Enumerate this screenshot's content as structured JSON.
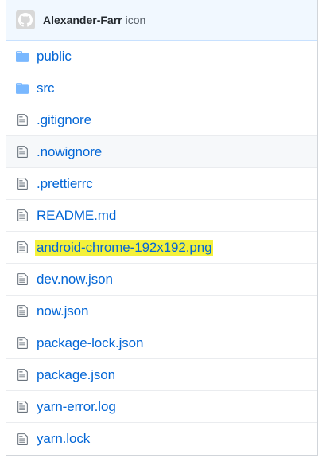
{
  "commit": {
    "author": "Alexander-Farr",
    "message": "icon"
  },
  "files": [
    {
      "name": "public",
      "type": "directory",
      "icon": "folder-icon"
    },
    {
      "name": "src",
      "type": "directory",
      "icon": "folder-icon"
    },
    {
      "name": ".gitignore",
      "type": "file",
      "icon": "file-icon"
    },
    {
      "name": ".nowignore",
      "type": "file",
      "icon": "file-icon",
      "hovered": true
    },
    {
      "name": ".prettierrc",
      "type": "file",
      "icon": "file-icon"
    },
    {
      "name": "README.md",
      "type": "file",
      "icon": "file-icon"
    },
    {
      "name": "android-chrome-192x192.png",
      "type": "file",
      "icon": "file-icon",
      "highlighted": true
    },
    {
      "name": "dev.now.json",
      "type": "file",
      "icon": "file-icon"
    },
    {
      "name": "now.json",
      "type": "file",
      "icon": "file-icon"
    },
    {
      "name": "package-lock.json",
      "type": "file",
      "icon": "file-icon"
    },
    {
      "name": "package.json",
      "type": "file",
      "icon": "file-icon"
    },
    {
      "name": "yarn-error.log",
      "type": "file",
      "icon": "file-icon"
    },
    {
      "name": "yarn.lock",
      "type": "file",
      "icon": "file-icon"
    }
  ],
  "colors": {
    "link": "#0366d6",
    "folder": "#79b8ff",
    "highlight": "#f4f13a"
  }
}
